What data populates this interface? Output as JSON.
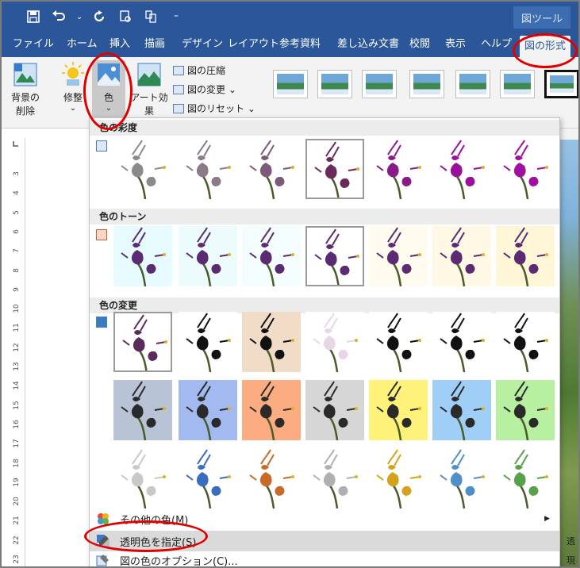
{
  "titlebar": {
    "context_label": "図ツール"
  },
  "tabs": [
    {
      "label": "ファイル"
    },
    {
      "label": "ホーム"
    },
    {
      "label": "挿入"
    },
    {
      "label": "描画"
    },
    {
      "label": "デザイン"
    },
    {
      "label": "レイアウト"
    },
    {
      "label": "参考資料"
    },
    {
      "label": "差し込み文書"
    },
    {
      "label": "校閲"
    },
    {
      "label": "表示"
    },
    {
      "label": "ヘルプ"
    },
    {
      "label": "図の形式"
    }
  ],
  "ribbon": {
    "remove_bg_line1": "背景の",
    "remove_bg_line2": "削除",
    "corrections": "修整",
    "color": "色",
    "artistic": "アート効果",
    "compress": "図の圧縮",
    "change": "図の変更 ⌄",
    "reset": "図のリセット ⌄",
    "chevron": "⌄"
  },
  "ruler": [
    "3",
    "4",
    "5",
    "6",
    "7",
    "8",
    "9",
    "10",
    "11",
    "12",
    "13",
    "14",
    "15",
    "16",
    "17",
    "18",
    "19",
    "20",
    "21",
    "22",
    "23"
  ],
  "dropdown": {
    "saturation_title": "色の彩度",
    "tone_title": "色のトーン",
    "recolor_title": "色の変更",
    "more_colors": "その他の色(M)",
    "set_transparent": "透明色を指定(S)",
    "color_options": "図の色のオプション(C)..."
  },
  "side_text": {
    "a": "透",
    "b": "現"
  },
  "colors": {
    "accent": "#2b579a",
    "annotation": "#e00000",
    "saturation": [
      "#8a8a8a",
      "#8a7a8a",
      "#7a5a78",
      "#6a2a5a",
      "#8a1a8a",
      "#9a109a",
      "#a010a0"
    ],
    "tone_bg": [
      "#e6fbff",
      "#ecfbfb",
      "#f4fdfd",
      "#ffffff",
      "#fffbee",
      "#fff8e4",
      "#fff6d8"
    ],
    "recolor_row1_bg": [
      "#ffffff",
      "#ffffff",
      "#f1dcc8",
      "#ffffff",
      "#ffffff",
      "#ffffff",
      "#ffffff"
    ],
    "recolor_row2_bg": [
      "#b9c3d6",
      "#a3baf1",
      "#fbac80",
      "#d6d6d6",
      "#fff27a",
      "#9fcff7",
      "#b6f0a0"
    ],
    "recolor_row3_fg": [
      "#c8c8c8",
      "#3a6cc0",
      "#c86a28",
      "#b0b0b0",
      "#d6a21c",
      "#4e8fc8",
      "#5aa04a"
    ]
  }
}
